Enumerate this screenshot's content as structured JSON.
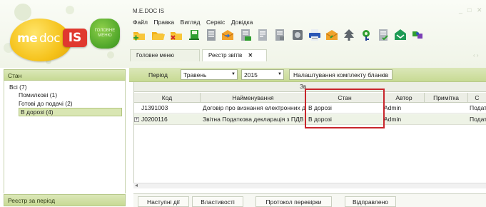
{
  "app": {
    "title": "M.E.DOC IS",
    "logo": {
      "part1": "me",
      "part2": "doc",
      "part3": "IS"
    },
    "home_button": "ГОЛОВНЕ МЕНЮ",
    "window_controls": {
      "minimize": "_",
      "maximize": "□",
      "close": "✕"
    }
  },
  "menu": [
    "Файл",
    "Правка",
    "Вигляд",
    "Сервіс",
    "Довідка"
  ],
  "toolbar": {
    "icons": [
      "folder-add-icon",
      "folder-open-icon",
      "folder-delete-icon",
      "save-green-icon",
      "document-icon",
      "send-orange-icon",
      "document-print-icon",
      "document-icon",
      "document-icon",
      "stamp-icon",
      "printer-icon",
      "send-orange-icon",
      "tree-icon",
      "key-icon",
      "document-check-icon",
      "envelope-green-icon",
      "puzzle-icon"
    ]
  },
  "tabs": [
    {
      "label": "Головне меню",
      "active": false
    },
    {
      "label": "Реєстр звітів",
      "active": true,
      "close": "✕"
    }
  ],
  "tabs_nav": "‹  ›",
  "left_panel": {
    "header": "Стан",
    "tree": [
      {
        "label": "Всі (7)",
        "level": 0,
        "selected": false
      },
      {
        "label": "Помилкові (1)",
        "level": 1,
        "selected": false
      },
      {
        "label": "Готові до подачі (2)",
        "level": 1,
        "selected": false
      },
      {
        "label": "В дорозі (4)",
        "level": 1,
        "selected": true
      }
    ],
    "footer": "Реєстр за період"
  },
  "filter": {
    "period_label": "Період",
    "month": "Травень",
    "year": "2015",
    "settings_button": "Налаштування комплекту бланків"
  },
  "grid": {
    "group_header": "Зв",
    "columns": [
      "Код",
      "Найменування",
      "Стан",
      "Автор",
      "Примітка",
      "С"
    ],
    "rows": [
      {
        "code": "J1391003",
        "name": "Договір про визнання електронних д",
        "state": "В дорозі",
        "author": "Admin",
        "note": "",
        "extra": "Подат"
      },
      {
        "code": "J0200116",
        "name": "Звітна  Податкова декларація з ПДВ",
        "state": "В дорозі",
        "author": "Admin",
        "note": "",
        "extra": "Подат"
      }
    ],
    "expander": "+"
  },
  "bottom_tabs": [
    "Наступні дії",
    "Властивості",
    "Протокол перевірки",
    "Відправлено"
  ],
  "colors": {
    "accent_green": "#c7da94",
    "highlight_red": "#c8252b",
    "logo_yellow": "#f5c21a",
    "logo_red": "#e0392f"
  }
}
